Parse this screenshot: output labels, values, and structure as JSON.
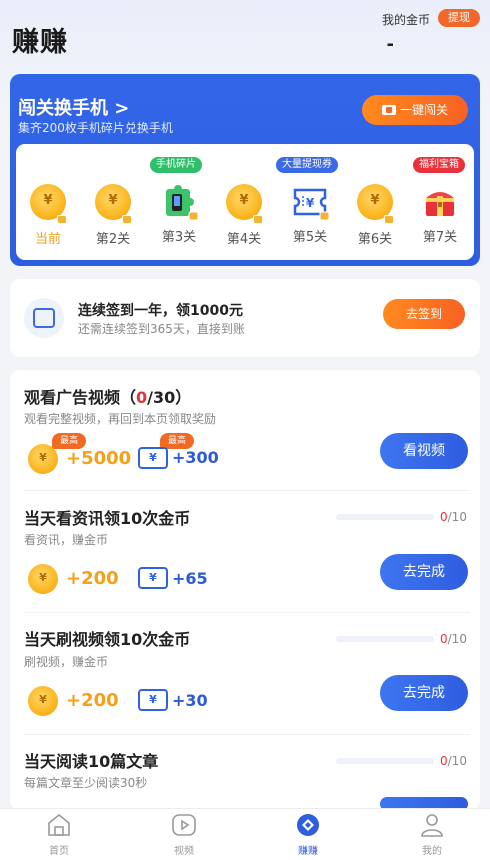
{
  "header": {
    "title": "赚赚",
    "coin_label": "我的金币",
    "withdraw_label": "提现",
    "coin_balance": "-"
  },
  "level_card": {
    "title": "闯关换手机 >",
    "subtitle": "集齐200枚手机碎片兑换手机",
    "button_label": "一键闯关",
    "levels": [
      {
        "label": "当前",
        "icon": "coin-icon",
        "current": true
      },
      {
        "label": "第2关",
        "icon": "coin-icon"
      },
      {
        "label": "第3关",
        "icon": "phone-fragment-icon",
        "tag": "手机碎片"
      },
      {
        "label": "第4关",
        "icon": "coin-icon"
      },
      {
        "label": "第5关",
        "icon": "coupon-icon",
        "tag": "大量提现券"
      },
      {
        "label": "第6关",
        "icon": "coin-icon"
      },
      {
        "label": "第7关",
        "icon": "treasure-chest-icon",
        "tag": "福利宝箱"
      }
    ],
    "tag_colors": {
      "green": "#2fbf6a",
      "blue": "#3b6ae6",
      "red": "#e8323a"
    }
  },
  "signin": {
    "title": "连续签到一年，领1000元",
    "subtitle": "还需连续签到365天，直接到账",
    "button_label": "去签到"
  },
  "tasks": {
    "video": {
      "title_prefix": "观看广告视频（",
      "title_count": "0",
      "title_suffix": "/30）",
      "desc": "观看完整视频，再回到本页领取奖励",
      "max_badge": "最高",
      "coin_reward": "+5000",
      "ticket_reward": "+300",
      "button_label": "看视频"
    },
    "news": {
      "title": "当天看资讯领10次金币",
      "desc": "看资讯，赚金币",
      "coin_reward": "+200",
      "ticket_reward": "+65",
      "progress_done": "0",
      "progress_total": "/10",
      "progress": 0,
      "button_label": "去完成"
    },
    "short_video": {
      "title": "当天刷视频领10次金币",
      "desc": "刷视频，赚金币",
      "coin_reward": "+200",
      "ticket_reward": "+30",
      "progress_done": "0",
      "progress_total": "/10",
      "progress": 0,
      "button_label": "去完成"
    },
    "read": {
      "title": "当天阅读10篇文章",
      "desc": "每篇文章至少阅读30秒",
      "progress_done": "0",
      "progress_total": "/10",
      "progress": 0
    },
    "ticket_glyph": "¥"
  },
  "nav": {
    "items": [
      {
        "label": "首页",
        "icon": "home-icon"
      },
      {
        "label": "视频",
        "icon": "video-icon"
      },
      {
        "label": "赚赚",
        "icon": "earn-icon",
        "active": true
      },
      {
        "label": "我的",
        "icon": "profile-icon"
      }
    ]
  },
  "colors": {
    "accent": "#2f5de0",
    "orange": "#f86222",
    "gold": "#f5a01a"
  }
}
